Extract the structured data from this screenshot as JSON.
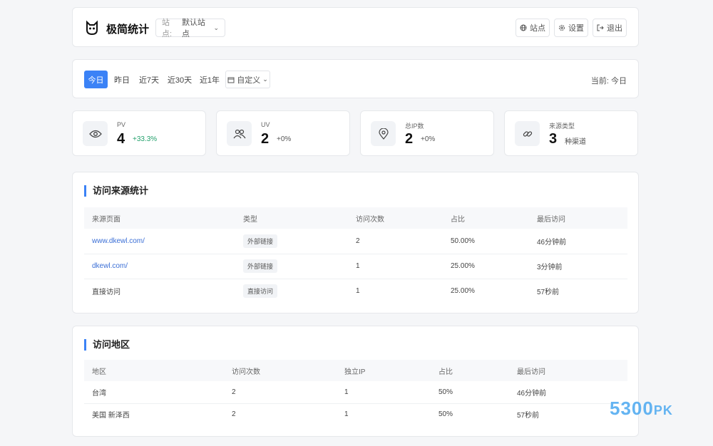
{
  "header": {
    "app_title": "极简统计",
    "site_select_key": "站点:",
    "site_select_value": "默认站点",
    "btn_sites": "站点",
    "btn_settings": "设置",
    "btn_logout": "退出"
  },
  "filter": {
    "tabs": [
      "今日",
      "昨日",
      "近7天",
      "近30天",
      "近1年"
    ],
    "custom": "自定义",
    "current": "当前: 今日"
  },
  "stats": [
    {
      "label": "PV",
      "value": "4",
      "change": "+33.3%",
      "icon": "eye-icon"
    },
    {
      "label": "UV",
      "value": "2",
      "change": "+0%",
      "icon": "users-icon"
    },
    {
      "label": "总IP数",
      "value": "2",
      "change": "+0%",
      "icon": "location-icon"
    },
    {
      "label": "来源类型",
      "value": "3",
      "change": "种渠道",
      "icon": "link-icon"
    }
  ],
  "sources": {
    "title": "访问来源统计",
    "headers": [
      "来源页面",
      "类型",
      "访问次数",
      "占比",
      "最后访问"
    ],
    "rows": [
      [
        "www.dkewl.com/",
        "外部链接",
        "2",
        "50.00%",
        "46分钟前"
      ],
      [
        "dkewl.com/",
        "外部链接",
        "1",
        "25.00%",
        "3分钟前"
      ],
      [
        "直接访问",
        "直接访问",
        "1",
        "25.00%",
        "57秒前"
      ]
    ]
  },
  "regions": {
    "title": "访问地区",
    "headers": [
      "地区",
      "访问次数",
      "独立IP",
      "占比",
      "最后访问"
    ],
    "rows": [
      [
        "台湾",
        "2",
        "1",
        "50%",
        "46分钟前"
      ],
      [
        "美国 新泽西",
        "2",
        "1",
        "50%",
        "57秒前"
      ]
    ]
  },
  "watermark": {
    "main": "5300",
    "suffix": "PK"
  },
  "colors": {
    "accent": "#3b82f6",
    "positive": "#22a06b",
    "link": "#3b6fd6"
  }
}
